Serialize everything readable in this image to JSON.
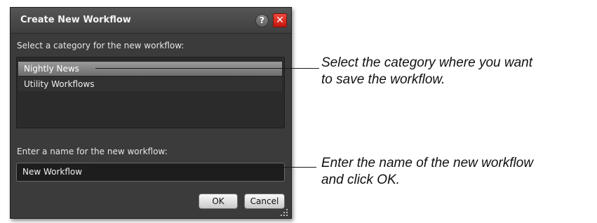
{
  "dialog": {
    "title": "Create New Workflow",
    "help_symbol": "?",
    "close_symbol": "✕",
    "category_label": "Select a category for the new workflow:",
    "categories": [
      {
        "label": "Nightly News",
        "selected": true
      },
      {
        "label": "Utility Workflows",
        "selected": false
      }
    ],
    "name_label": "Enter a name for the new workflow:",
    "name_value": "New Workflow",
    "ok_label": "OK",
    "cancel_label": "Cancel"
  },
  "annotations": {
    "category_line1": "Select the category where you want",
    "category_line2": "to save the workflow.",
    "name_line1": "Enter the name of the new workflow",
    "name_line2": "and click OK."
  },
  "colors": {
    "dialog_bg": "#3b3b3b",
    "close_red": "#d8241a",
    "selected_row": "#8c8c8c"
  },
  "icons": [
    "help-icon",
    "close-icon",
    "resize-grip-icon"
  ]
}
